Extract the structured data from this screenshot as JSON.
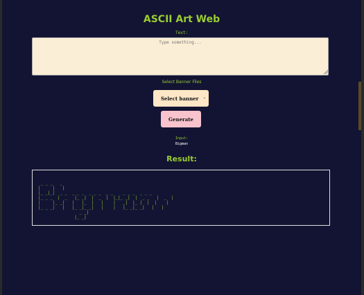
{
  "app": {
    "title": "ASCII Art Web"
  },
  "form": {
    "text_label": "Text:",
    "text_placeholder": "Type something...",
    "text_value": "",
    "banner_label": "Select Banner Files",
    "banner_select_value": "Select banner",
    "generate_label": "Generate"
  },
  "echo": {
    "label": "Input:",
    "value": "Bigman"
  },
  "result": {
    "heading": "Result:",
    "ascii": " _ _ _   _\n|     |   |\n|_ _|_|  _ _  _ _ _  _ _ _  _ _    _ _ _  _ _ _\n|_ _ _  |  _   |_ _|  |  _  |  |_|_ _|  |  _ _   |  _  |\n|     |_ _|   |   |_  |   |    |   _|  |_ |  |  |    |\n|_ _ _|   |   |_ _|_ _|   |    |   |_ _|_ _|   |   |\n                 _ _|\n               |_ _|"
  },
  "colors": {
    "background": "#131433",
    "accent": "#9acd32",
    "input_bg": "#fbeed6",
    "select_bg": "#fde7c7",
    "generate_bg": "#f8c3cd"
  }
}
